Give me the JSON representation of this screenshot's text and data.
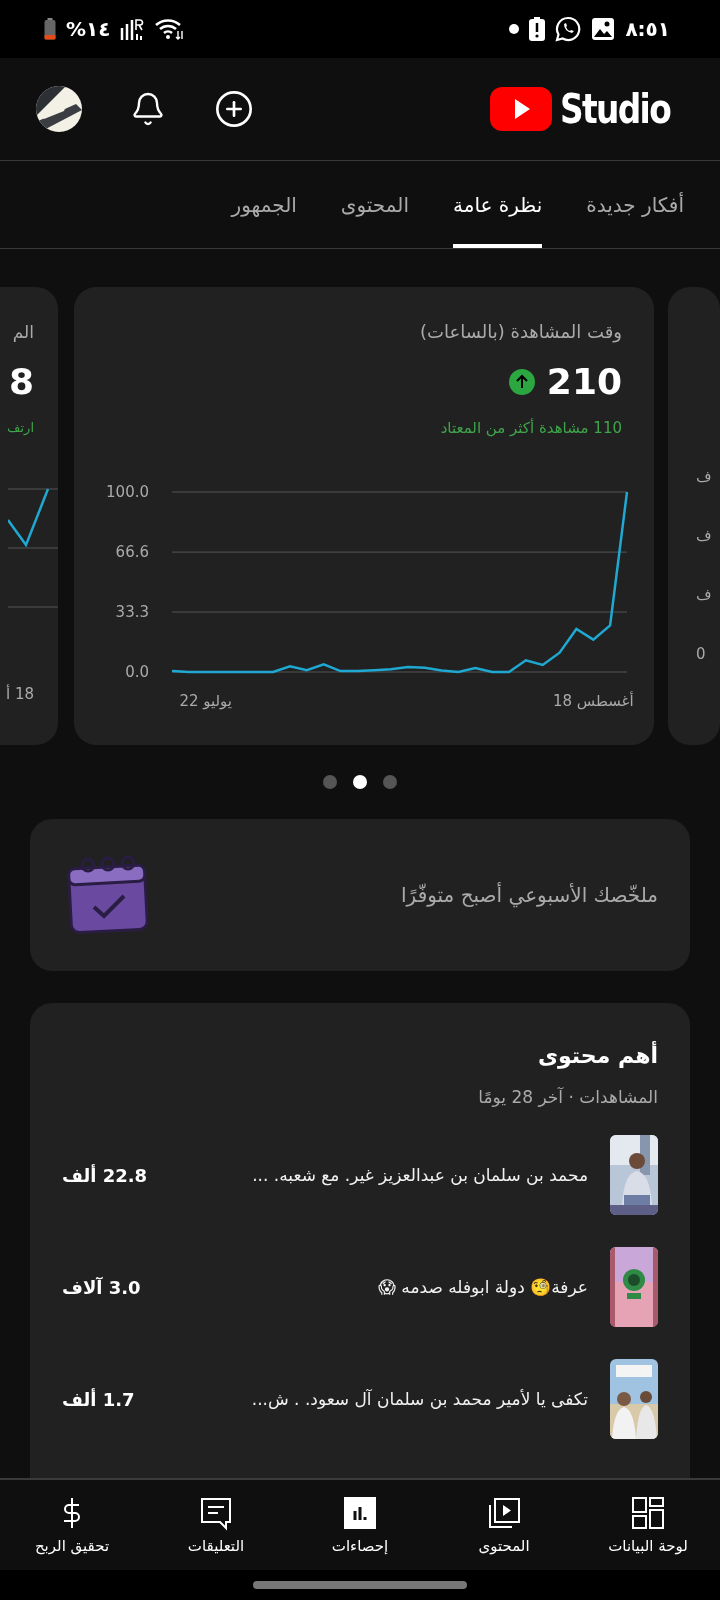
{
  "status_bar": {
    "battery": "%١٤",
    "time": "٨:٥١"
  },
  "header": {
    "logo_text": "Studio"
  },
  "tabs": [
    {
      "label": "أفكار جديدة",
      "selected": false
    },
    {
      "label": "نظرة عامة",
      "selected": true
    },
    {
      "label": "المحتوى",
      "selected": false
    },
    {
      "label": "الجمهور",
      "selected": false
    }
  ],
  "cards": {
    "previous": {
      "title": "الم",
      "value": "8",
      "note": "ارتف",
      "x_label": "18 أ"
    },
    "current": {
      "title": "وقت المشاهدة (بالساعات)",
      "value": "210",
      "note": "110 مشاهدة أكثر من المعتاد",
      "chart_data": {
        "type": "line",
        "categories": [
          null,
          null,
          "22 يوليو",
          null,
          null,
          null,
          null,
          null,
          null,
          null,
          null,
          null,
          null,
          null,
          null,
          null,
          null,
          null,
          null,
          null,
          null,
          null,
          null,
          null,
          null,
          "18 أغسطس",
          null,
          null
        ],
        "series": [
          {
            "color": "#1ea8d2",
            "values": [
              0.5,
              0,
              0,
              0,
              0,
              0,
              0,
              3.1,
              1,
              4.2,
              0.5,
              0.5,
              1,
              1.5,
              2.8,
              2.4,
              0.9,
              0,
              2.2,
              0,
              0,
              6.5,
              3.9,
              10.7,
              23.9,
              18,
              25.9,
              100
            ]
          }
        ],
        "ylim": [
          0,
          100
        ],
        "yticks": [
          {
            "value": 0,
            "label": "0.0"
          },
          {
            "value": 33.3,
            "label": "33.3"
          },
          {
            "value": 66.6,
            "label": "66.6"
          },
          {
            "value": 100,
            "label": "100.0"
          }
        ]
      }
    },
    "next": {
      "y_labels": [
        "ف",
        "ف",
        "ف",
        "0"
      ]
    }
  },
  "pager": [
    {
      "selected": false
    },
    {
      "selected": true
    },
    {
      "selected": false
    }
  ],
  "weekly_summary": {
    "text": "ملخّصك الأسبوعي أصبح متوفّرًا"
  },
  "top_content": {
    "title": "أهم محتوى",
    "subtitle": "المشاهدات · آخر 28 يومًا",
    "rows": [
      {
        "title": "محمد بن سلمان بن عبدالعزيز  غير. مع شعبه. ...",
        "views": "22.8 ألف"
      },
      {
        "title": "عرفة🧐 دولة ابوفله صدمه 😱",
        "views": "3.0 آلاف"
      },
      {
        "title": "تكفى يا لأمير  محمد بن سلمان آل سعود.  .  ش...",
        "views": "1.7 ألف"
      }
    ]
  },
  "bottom_nav": [
    {
      "label": "لوحة البيانات",
      "kind": "dashboard",
      "selected": false
    },
    {
      "label": "المحتوى",
      "kind": "content",
      "selected": false
    },
    {
      "label": "إحصاءات",
      "kind": "analytics",
      "selected": true
    },
    {
      "label": "التعليقات",
      "kind": "comments",
      "selected": false
    },
    {
      "label": "تحقيق الربح",
      "kind": "earn",
      "selected": false
    }
  ]
}
